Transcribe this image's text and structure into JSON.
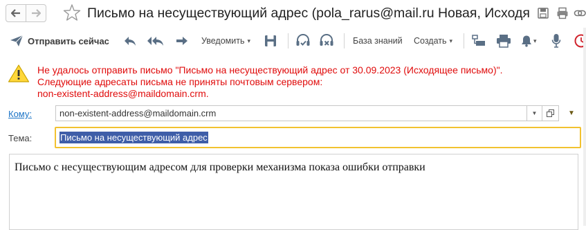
{
  "window": {
    "title": "Письмо на несуществующий адрес (pola_rarus@mail.ru Новая, Исходя..."
  },
  "toolbar": {
    "send_now": "Отправить сейчас",
    "notify": "Уведомить",
    "knowledge_base": "База знаний",
    "create": "Создать"
  },
  "error": {
    "line1": "Не удалось отправить письмо \"Письмо на несуществующий адрес от 30.09.2023 (Исходящее письмо)\".",
    "line2": "Следующие адресаты письма не приняты почтовым сервером:",
    "line3": "non-existent-address@maildomain.crm."
  },
  "form": {
    "to_label": "Кому:",
    "to_value": "non-existent-address@maildomain.crm",
    "subject_label": "Тема:",
    "subject_value": "Письмо на несуществующий адрес",
    "body_text": "Письмо с несуществующим адресом для проверки механизма показа ошибки отправки"
  },
  "colors": {
    "error_text": "#e00b0b",
    "link": "#1a73c6",
    "subject_border": "#f2c230",
    "selection": "#3f5ea8",
    "alert_clock": "#d0242d"
  }
}
